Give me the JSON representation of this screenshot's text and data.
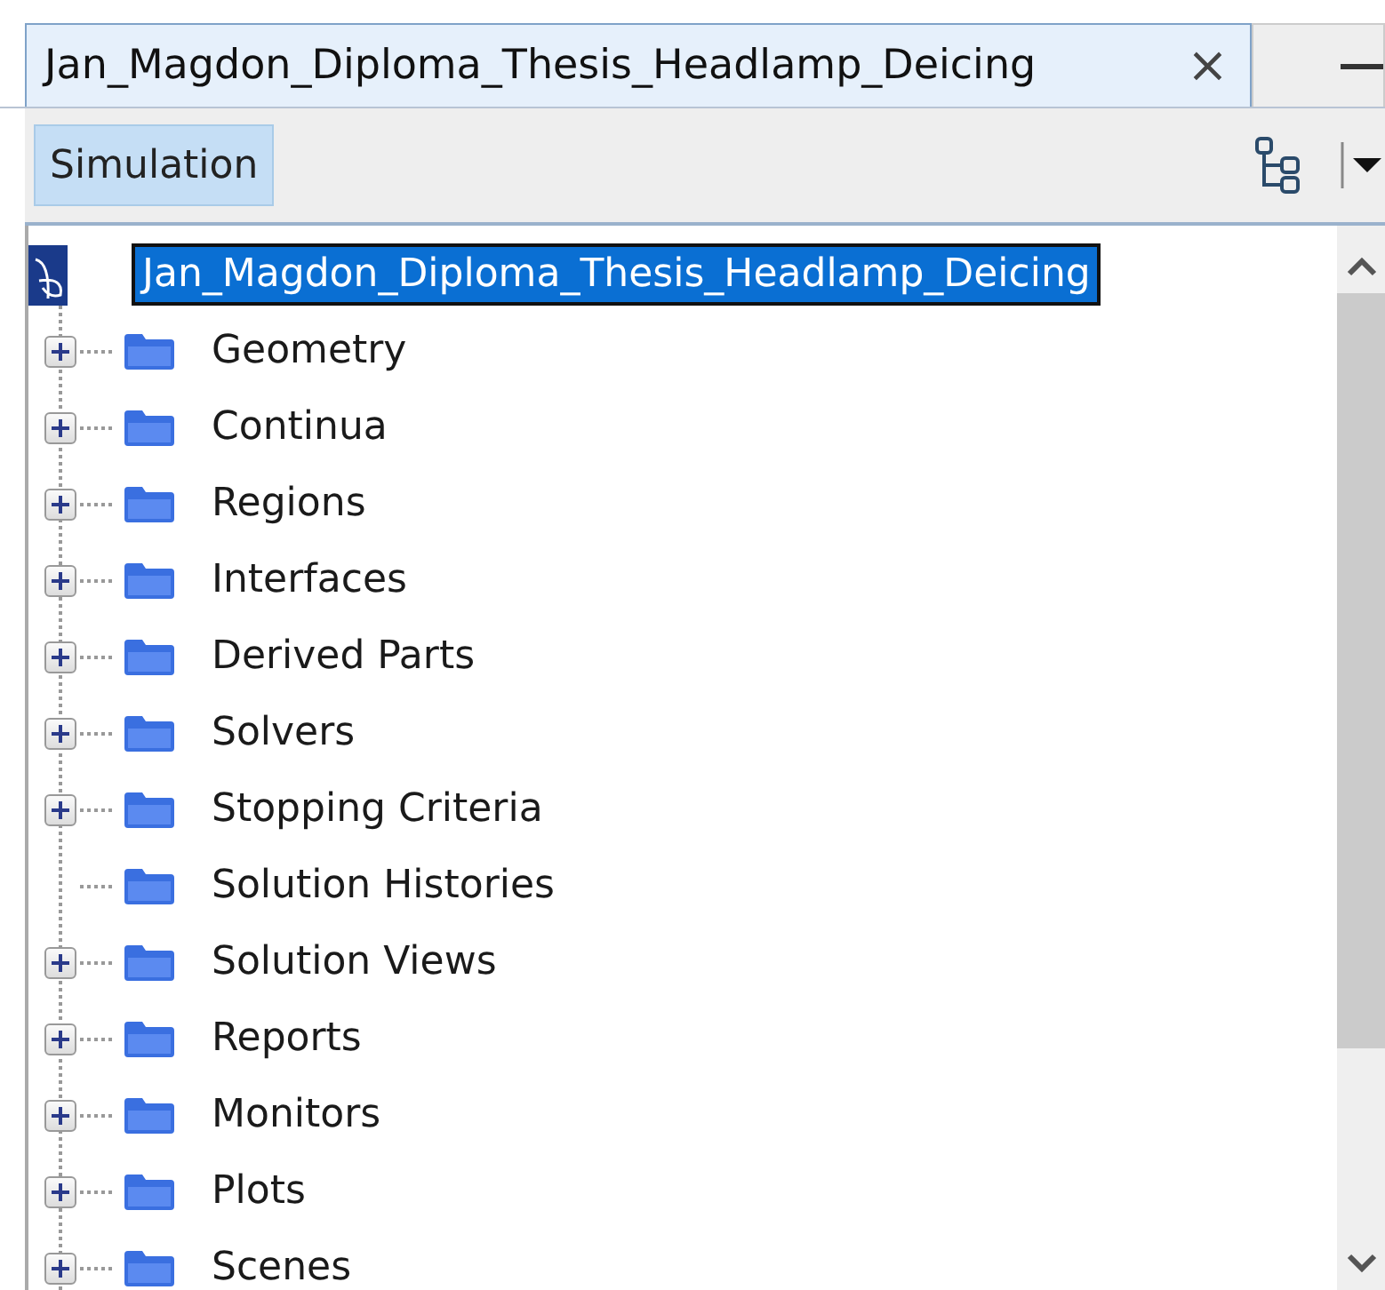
{
  "tab": {
    "title": "Jan_Magdon_Diploma_Thesis_Headlamp_Deicing",
    "close": "×",
    "selected": true
  },
  "toolbar": {
    "label": "Simulation",
    "selected": true
  },
  "tree": {
    "root": {
      "label": "Jan_Magdon_Diploma_Thesis_Headlamp_Deicing",
      "selected": true
    },
    "children": [
      {
        "label": "Geometry",
        "expandable": true
      },
      {
        "label": "Continua",
        "expandable": true
      },
      {
        "label": "Regions",
        "expandable": true
      },
      {
        "label": "Interfaces",
        "expandable": true
      },
      {
        "label": "Derived Parts",
        "expandable": true
      },
      {
        "label": "Solvers",
        "expandable": true
      },
      {
        "label": "Stopping Criteria",
        "expandable": true
      },
      {
        "label": "Solution Histories",
        "expandable": false
      },
      {
        "label": "Solution Views",
        "expandable": true
      },
      {
        "label": "Reports",
        "expandable": true
      },
      {
        "label": "Monitors",
        "expandable": true
      },
      {
        "label": "Plots",
        "expandable": true
      },
      {
        "label": "Scenes",
        "expandable": true
      }
    ]
  }
}
